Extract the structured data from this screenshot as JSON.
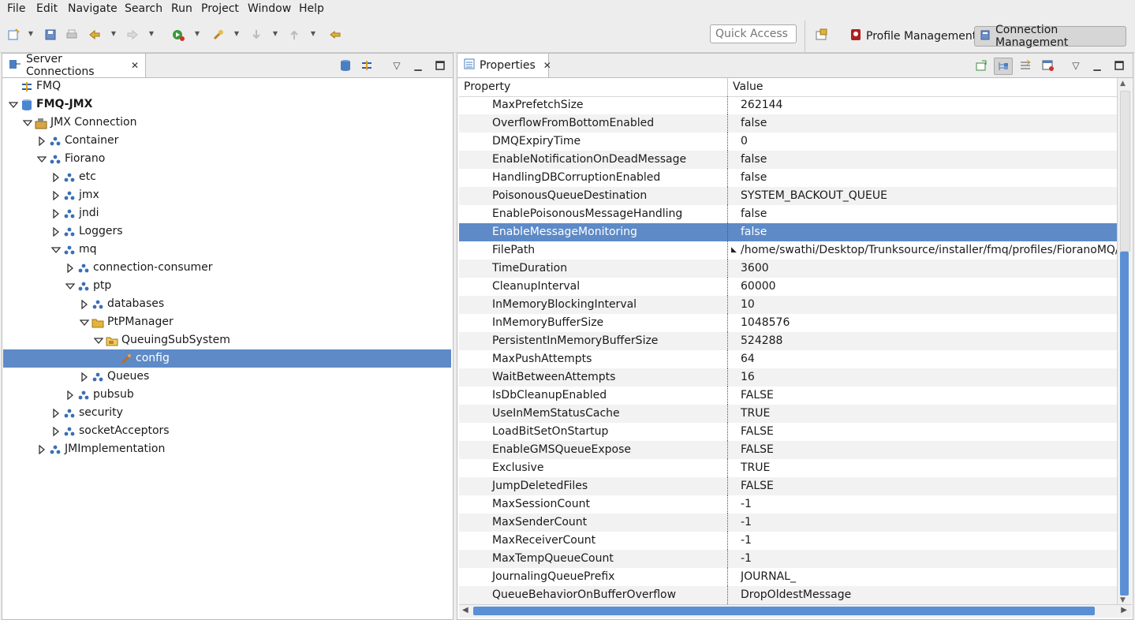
{
  "menu": [
    "File",
    "Edit",
    "Navigate",
    "Search",
    "Run",
    "Project",
    "Window",
    "Help"
  ],
  "toolbar": {
    "quick_access_placeholder": "Quick Access",
    "perspective_profile": "Profile Management",
    "perspective_connection": "Connection Management"
  },
  "server_panel": {
    "tab_title": "Server Connections",
    "tree": [
      {
        "label": "FMQ",
        "level": 0,
        "twisty": "none",
        "icon": "fmq-server-icon"
      },
      {
        "label": "FMQ-JMX",
        "level": 0,
        "twisty": "open",
        "icon": "jmx-server-icon",
        "bold": true
      },
      {
        "label": "JMX Connection",
        "level": 1,
        "twisty": "open",
        "icon": "connection-icon"
      },
      {
        "label": "Container",
        "level": 2,
        "twisty": "closed",
        "icon": "mbean-domain-icon"
      },
      {
        "label": "Fiorano",
        "level": 2,
        "twisty": "open",
        "icon": "mbean-domain-icon"
      },
      {
        "label": "etc",
        "level": 3,
        "twisty": "closed",
        "icon": "mbean-domain-icon"
      },
      {
        "label": "jmx",
        "level": 3,
        "twisty": "closed",
        "icon": "mbean-domain-icon"
      },
      {
        "label": "jndi",
        "level": 3,
        "twisty": "closed",
        "icon": "mbean-domain-icon"
      },
      {
        "label": "Loggers",
        "level": 3,
        "twisty": "closed",
        "icon": "mbean-domain-icon"
      },
      {
        "label": "mq",
        "level": 3,
        "twisty": "open",
        "icon": "mbean-domain-icon"
      },
      {
        "label": "connection-consumer",
        "level": 4,
        "twisty": "closed",
        "icon": "mbean-domain-icon"
      },
      {
        "label": "ptp",
        "level": 4,
        "twisty": "open",
        "icon": "mbean-domain-icon"
      },
      {
        "label": "databases",
        "level": 5,
        "twisty": "closed",
        "icon": "mbean-domain-icon"
      },
      {
        "label": "PtPManager",
        "level": 5,
        "twisty": "open",
        "icon": "folder-icon"
      },
      {
        "label": "QueuingSubSystem",
        "level": 6,
        "twisty": "open",
        "icon": "folder-open-icon"
      },
      {
        "label": "config",
        "level": 7,
        "twisty": "none",
        "icon": "config-bean-icon",
        "selected": true
      },
      {
        "label": "Queues",
        "level": 5,
        "twisty": "closed",
        "icon": "mbean-domain-icon"
      },
      {
        "label": "pubsub",
        "level": 4,
        "twisty": "closed",
        "icon": "mbean-domain-icon"
      },
      {
        "label": "security",
        "level": 3,
        "twisty": "closed",
        "icon": "mbean-domain-icon"
      },
      {
        "label": "socketAcceptors",
        "level": 3,
        "twisty": "closed",
        "icon": "mbean-domain-icon"
      },
      {
        "label": "JMImplementation",
        "level": 2,
        "twisty": "closed",
        "icon": "mbean-domain-icon"
      }
    ]
  },
  "properties_panel": {
    "tab_title": "Properties",
    "col_property": "Property",
    "col_value": "Value",
    "rows": [
      {
        "name": "MaxPrefetchSize",
        "value": "262144"
      },
      {
        "name": "OverflowFromBottomEnabled",
        "value": "false"
      },
      {
        "name": "DMQExpiryTime",
        "value": "0"
      },
      {
        "name": "EnableNotificationOnDeadMessage",
        "value": "false"
      },
      {
        "name": "HandlingDBCorruptionEnabled",
        "value": "false"
      },
      {
        "name": "PoisonousQueueDestination",
        "value": "SYSTEM_BACKOUT_QUEUE"
      },
      {
        "name": "EnablePoisonousMessageHandling",
        "value": "false"
      },
      {
        "name": "EnableMessageMonitoring",
        "value": "false",
        "selected": true
      },
      {
        "name": "FilePath",
        "value": "/home/swathi/Desktop/Trunksource/installer/fmq/profiles/FioranoMQ/run/",
        "marker": true
      },
      {
        "name": "TimeDuration",
        "value": "3600"
      },
      {
        "name": "CleanupInterval",
        "value": "60000"
      },
      {
        "name": "InMemoryBlockingInterval",
        "value": "10"
      },
      {
        "name": "InMemoryBufferSize",
        "value": "1048576"
      },
      {
        "name": "PersistentInMemoryBufferSize",
        "value": "524288"
      },
      {
        "name": "MaxPushAttempts",
        "value": "64"
      },
      {
        "name": "WaitBetweenAttempts",
        "value": "16"
      },
      {
        "name": "IsDbCleanupEnabled",
        "value": "FALSE"
      },
      {
        "name": "UseInMemStatusCache",
        "value": "TRUE"
      },
      {
        "name": "LoadBitSetOnStartup",
        "value": "FALSE"
      },
      {
        "name": "EnableGMSQueueExpose",
        "value": "FALSE"
      },
      {
        "name": "Exclusive",
        "value": "TRUE"
      },
      {
        "name": "JumpDeletedFiles",
        "value": "FALSE"
      },
      {
        "name": "MaxSessionCount",
        "value": "-1"
      },
      {
        "name": "MaxSenderCount",
        "value": "-1"
      },
      {
        "name": "MaxReceiverCount",
        "value": "-1"
      },
      {
        "name": "MaxTempQueueCount",
        "value": "-1"
      },
      {
        "name": "JournalingQueuePrefix",
        "value": "JOURNAL_"
      },
      {
        "name": "QueueBehaviorOnBufferOverflow",
        "value": "DropOldestMessage"
      }
    ]
  },
  "colors": {
    "selection": "#5e8ac7",
    "mbean_icon": "#3a6fb5",
    "folder": "#e2b43a",
    "scroll_thumb": "#5a8fd6"
  }
}
